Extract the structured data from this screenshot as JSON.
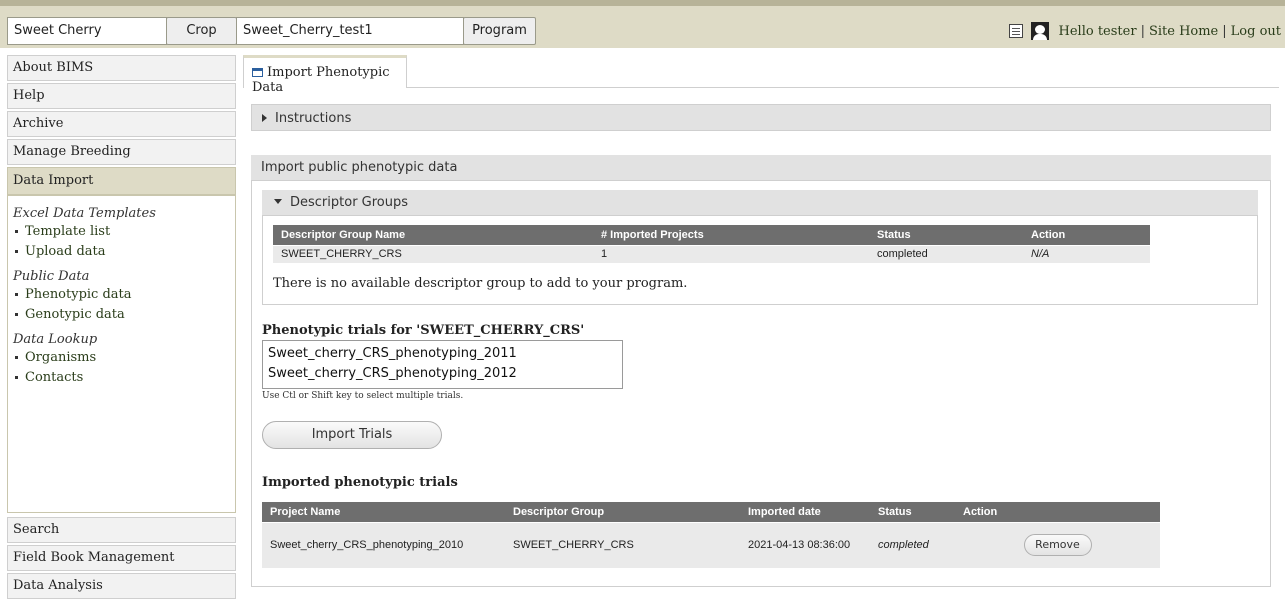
{
  "topbar": {
    "crop_value": "Sweet Cherry",
    "crop_button": "Crop",
    "program_value": "Sweet_Cherry_test1",
    "program_button": "Program",
    "greeting": "Hello tester",
    "separator": "|",
    "site_home": "Site Home",
    "logout": "Log out",
    "icons": [
      "grid-icon",
      "user-icon"
    ]
  },
  "sidebar": {
    "items_top": [
      "About BIMS",
      "Help",
      "Archive",
      "Manage Breeding"
    ],
    "active_item": "Data Import",
    "sections": [
      {
        "title": "Excel Data Templates",
        "links": [
          "Template list",
          "Upload data"
        ]
      },
      {
        "title": "Public Data",
        "links": [
          "Phenotypic data",
          "Genotypic data"
        ]
      },
      {
        "title": "Data Lookup",
        "links": [
          "Organisms",
          "Contacts"
        ]
      }
    ],
    "items_bottom": [
      "Search",
      "Field Book Management",
      "Data Analysis"
    ]
  },
  "main": {
    "tab_label": "Import Phenotypic Data",
    "instructions_label": "Instructions",
    "panel_title": "Import public phenotypic data",
    "descriptor_groups_label": "Descriptor Groups",
    "descriptor_table": {
      "headers": [
        "Descriptor Group Name",
        "# Imported Projects",
        "Status",
        "Action"
      ],
      "rows": [
        [
          "SWEET_CHERRY_CRS",
          "1",
          "completed",
          "N/A"
        ]
      ]
    },
    "no_group_text": "There is no available descriptor group to add to your program.",
    "trials_title": "Phenotypic trials for 'SWEET_CHERRY_CRS'",
    "trials_options": [
      "Sweet_cherry_CRS_phenotyping_2011",
      "Sweet_cherry_CRS_phenotyping_2012"
    ],
    "trials_hint": "Use Ctl or Shift key to select multiple trials.",
    "import_button": "Import Trials",
    "imported_title": "Imported phenotypic trials",
    "imported_table": {
      "headers": [
        "Project Name",
        "Descriptor Group",
        "Imported date",
        "Status",
        "Action"
      ],
      "rows": [
        [
          "Sweet_cherry_CRS_phenotyping_2010",
          "SWEET_CHERRY_CRS",
          "2021-04-13 08:36:00",
          "completed",
          "Remove"
        ]
      ]
    }
  }
}
